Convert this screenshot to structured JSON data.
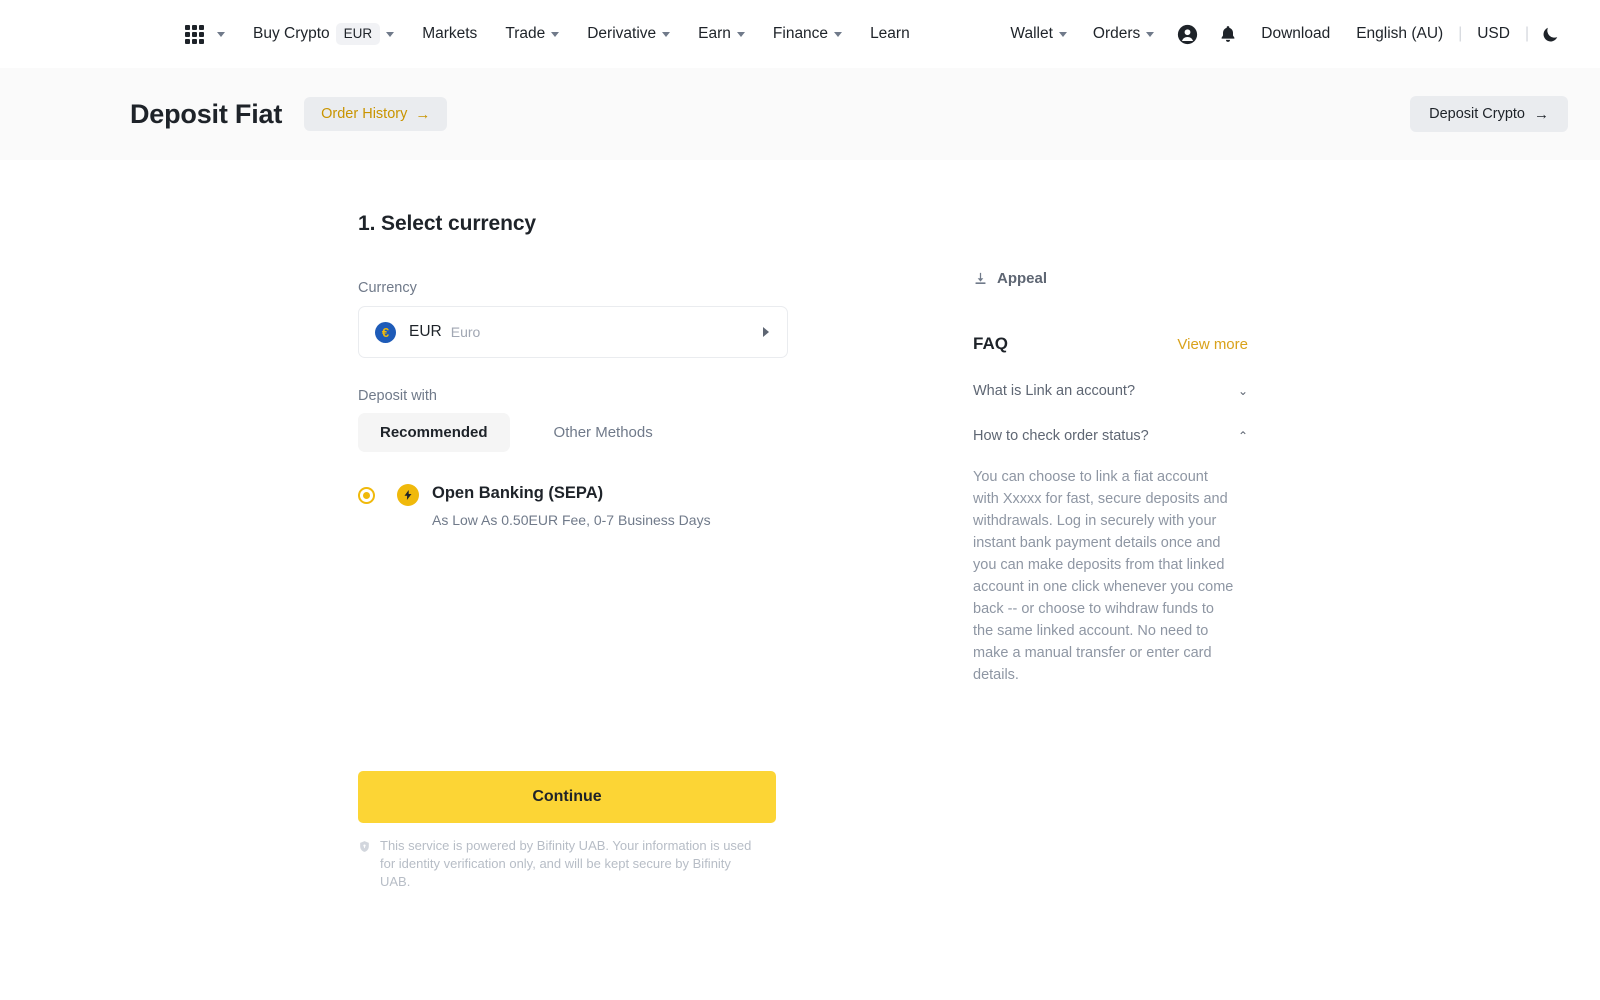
{
  "navbar": {
    "apps_icon": "grid-apps-icon",
    "items": [
      {
        "label": "Buy Crypto",
        "badge": "EUR",
        "has_caret": true
      },
      {
        "label": "Markets",
        "has_caret": false
      },
      {
        "label": "Trade",
        "has_caret": true
      },
      {
        "label": "Derivative",
        "has_caret": true
      },
      {
        "label": "Earn",
        "has_caret": true
      },
      {
        "label": "Finance",
        "has_caret": true
      },
      {
        "label": "Learn",
        "has_caret": false
      }
    ],
    "right": {
      "wallet": "Wallet",
      "orders": "Orders",
      "profile_icon": "user-circle-icon",
      "notification_icon": "bell-icon",
      "download": "Download",
      "language": "English (AU)",
      "currency": "USD",
      "theme_icon": "moon-icon",
      "divider": "|"
    }
  },
  "header": {
    "title": "Deposit Fiat",
    "order_history": "Order History",
    "order_history_arrow": "→",
    "deposit_crypto": "Deposit Crypto",
    "deposit_crypto_arrow": "→"
  },
  "main": {
    "step_title": "1. Select currency",
    "currency_label": "Currency",
    "currency": {
      "symbol": "€",
      "code": "EUR",
      "name": "Euro",
      "coin_bg": "#1e5bb8",
      "coin_fg": "#f0b90b"
    },
    "deposit_with_label": "Deposit with",
    "tabs": [
      {
        "label": "Recommended",
        "active": true
      },
      {
        "label": "Other Methods",
        "active": false
      }
    ],
    "method": {
      "name": "Open Banking (SEPA)",
      "subtitle": "As Low As 0.50EUR Fee, 0-7 Business Days",
      "selected": true,
      "icon": "lightning-bolt-icon"
    },
    "continue_label": "Continue",
    "continue_color": "#fcd535",
    "disclaimer_icon": "shield-icon",
    "disclaimer": "This service is powered by Bifinity UAB. Your information is used for identity verification only, and will be kept secure by Bifinity UAB."
  },
  "sidebar": {
    "appeal": "Appeal",
    "appeal_icon": "appeal-download-icon",
    "faq_title": "FAQ",
    "view_more": "View more",
    "accent_color": "#d9a21b",
    "faqs": [
      {
        "question": "What is Link an account?",
        "expanded": false,
        "chevron": "⌄"
      },
      {
        "question": "How to check order status?",
        "expanded": true,
        "chevron": "⌃"
      }
    ],
    "faq_answer": "You can choose to link a fiat account with Xxxxx for fast, secure deposits and withdrawals. Log in securely with your instant bank payment details once and you can make deposits from that linked account in one click whenever you come back -- or choose to wihdraw funds to the same linked account. No need to make a manual transfer or enter card details."
  }
}
